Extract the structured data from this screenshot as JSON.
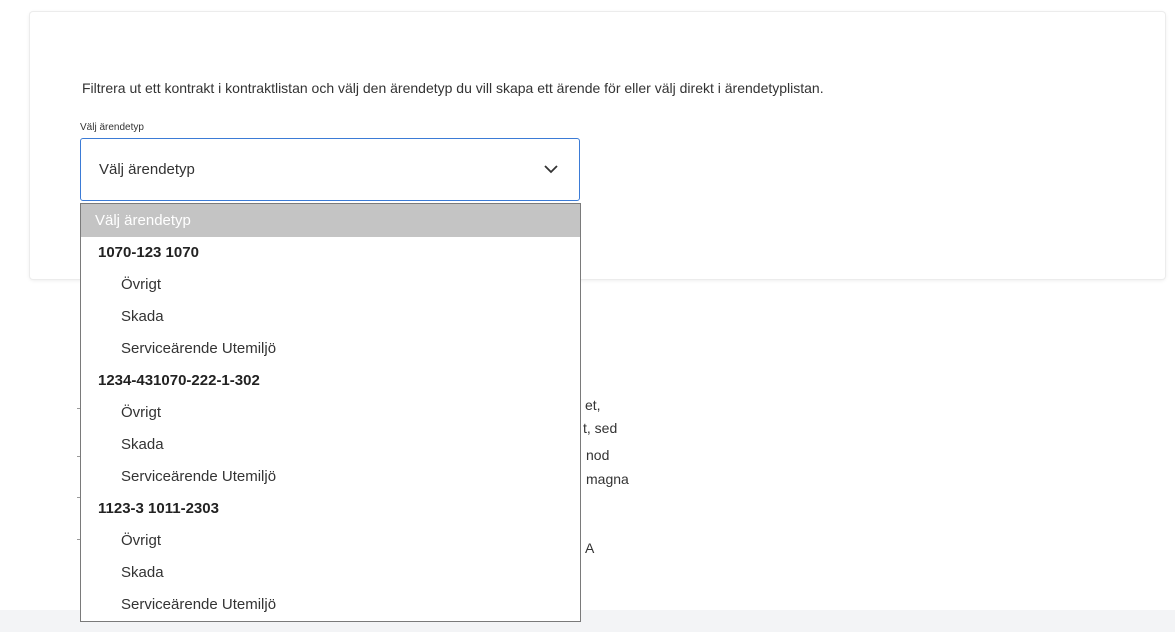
{
  "intro": "Filtrera ut ett kontrakt i kontraktlistan och välj den ärendetyp du vill skapa ett ärende för eller välj direkt i ärendetyplistan.",
  "field_label": "Välj ärendetyp",
  "select": {
    "value": "Välj ärendetyp",
    "icon": "chevron-down-icon"
  },
  "dropdown": {
    "placeholder": "Välj ärendetyp",
    "groups": [
      {
        "label": "1070-123 1070",
        "items": [
          "Övrigt",
          "Skada",
          "Serviceärende Utemiljö"
        ]
      },
      {
        "label": "1234-431070-222-1-302",
        "items": [
          "Övrigt",
          "Skada",
          "Serviceärende Utemiljö"
        ]
      },
      {
        "label": "1123-3 1011-2303",
        "items": [
          "Övrigt",
          "Skada",
          "Serviceärende Utemiljö"
        ]
      }
    ]
  },
  "background_fragments": [
    "et,",
    "t, sed",
    "nod",
    "magna",
    "A"
  ]
}
